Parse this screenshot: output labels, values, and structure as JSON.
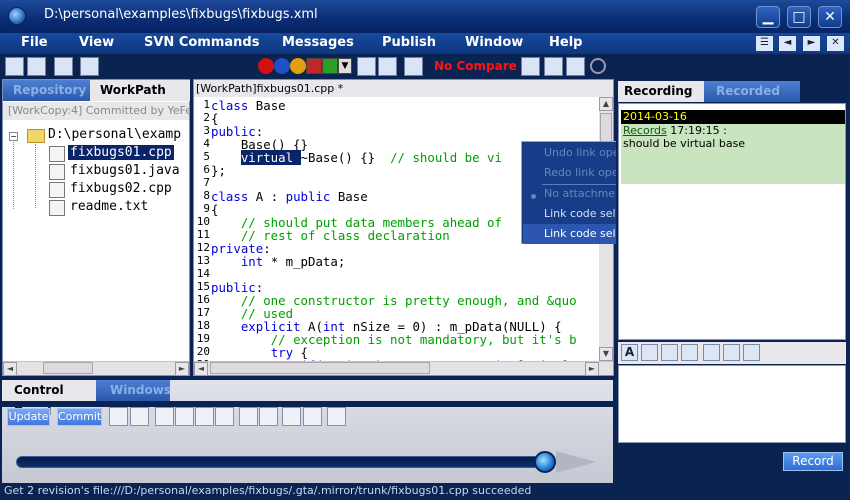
{
  "window": {
    "title": "D:\\personal\\examples\\fixbugs\\fixbugs.xml",
    "controls": {
      "minimize": "▁",
      "maximize": "□",
      "close": "✕"
    }
  },
  "menu": {
    "items": [
      "File",
      "View",
      "SVN Commands",
      "Messages",
      "Publish",
      "Window",
      "Help"
    ]
  },
  "toolbar": {
    "compare_label": "No Compare",
    "compare_color": "#ff1414"
  },
  "left_panel": {
    "tabs": [
      "Repository",
      "WorkPath"
    ],
    "active_tab": "WorkPath",
    "workcopy_label": "[WorkCopy:4] Committed by YeFe...",
    "tree": {
      "root": "D:\\personal\\examp",
      "files": [
        "fixbugs01.cpp",
        "fixbugs01.java",
        "fixbugs02.cpp",
        "readme.txt"
      ],
      "selected": "fixbugs01.cpp"
    }
  },
  "editor": {
    "tab_label": "[WorkPath]fixbugs01.cpp *",
    "lines": [
      {
        "n": "1",
        "text": "class Base"
      },
      {
        "n": "2",
        "text": "{"
      },
      {
        "n": "3",
        "text": "public:"
      },
      {
        "n": "4",
        "text": "    Base() {}"
      },
      {
        "n": "5",
        "pre": "    ",
        "hl": "virtual ",
        "text": "~Base() {}  // should be vi"
      },
      {
        "n": "6",
        "text": "};"
      },
      {
        "n": "7",
        "text": ""
      },
      {
        "n": "8",
        "text": "class A : public Base"
      },
      {
        "n": "9",
        "text": "{"
      },
      {
        "n": "10",
        "text": "    // should put data members ahead of"
      },
      {
        "n": "11",
        "text": "    // rest of class declaration"
      },
      {
        "n": "12",
        "text": "private:"
      },
      {
        "n": "13",
        "text": "    int * m_pData;"
      },
      {
        "n": "14",
        "text": ""
      },
      {
        "n": "15",
        "text": "public:"
      },
      {
        "n": "16",
        "text": "    // one constructor is pretty enough, and &quo"
      },
      {
        "n": "17",
        "text": "    // used"
      },
      {
        "n": "18",
        "text": "    explicit A(int nSize = 0) : m_pData(NULL) {"
      },
      {
        "n": "19",
        "text": "        // exception is not mandatory, but it's b"
      },
      {
        "n": "20",
        "text": "        try {"
      },
      {
        "n": "21",
        "text": "            if( nSize ) m_pData = new int[nSize];"
      }
    ]
  },
  "context_menu": {
    "items": [
      {
        "label": "Undo link operation",
        "state": "disabled"
      },
      {
        "label": "Redo link operation",
        "state": "disabled"
      },
      {
        "label": "No attachment",
        "state": "disabled"
      },
      {
        "label": "Link code selection",
        "state": "enabled"
      },
      {
        "label": "Link code selection and changes",
        "state": "highlighted"
      }
    ]
  },
  "right_panel": {
    "tabs": [
      "Recording",
      "Recorded"
    ],
    "active_tab": "Recording",
    "date": "2014-03-16",
    "record_link": "Records",
    "record_time": " 17:19:15 :",
    "record_note": "should be virtual base",
    "record_button": "Record"
  },
  "control_panel": {
    "tabs": [
      "Control Panel",
      "Windows"
    ],
    "active_tab": "Control Panel",
    "update_label": "Update",
    "commit_label": "Commit"
  },
  "status_bar": {
    "text": "Get 2 revision's file:///D:/personal/examples/fixbugs/.gta/.mirror/trunk/fixbugs01.cpp succeeded"
  }
}
